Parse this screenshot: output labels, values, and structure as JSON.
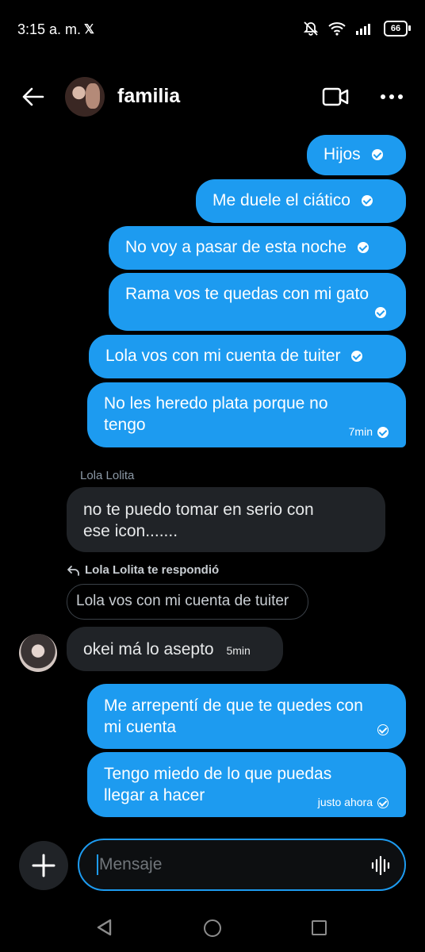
{
  "status_bar": {
    "time": "3:15 a. m.",
    "app_icon": "x-logo",
    "battery": "66"
  },
  "header": {
    "title": "familia"
  },
  "sent_messages_top": [
    {
      "text": "Hijos"
    },
    {
      "text": "Me duele el ciático"
    },
    {
      "text": "No voy a pasar de esta noche"
    },
    {
      "text": "Rama vos te quedas con mi gato"
    },
    {
      "text": "Lola vos con mi cuenta de tuiter"
    },
    {
      "line1": "No les heredo plata porque no",
      "line2": "tengo",
      "time": "7min"
    }
  ],
  "received": {
    "sender": "Lola Lolita",
    "line1": "no te puedo tomar en serio con",
    "line2": "ese icon......."
  },
  "reply": {
    "note": "Lola Lolita te respondió",
    "quoted": "Lola vos con mi cuenta de tuiter",
    "text": "okei má lo asepto",
    "time": "5min"
  },
  "sent_messages_bottom": [
    {
      "line1": "Me arrepentí de que te quedes con",
      "line2": "mi cuenta"
    },
    {
      "line1": "Tengo miedo de lo que puedas",
      "line2": "llegar a hacer",
      "time": "justo ahora"
    }
  ],
  "composer": {
    "placeholder": "Mensaje"
  },
  "colors": {
    "accent": "#1d9bf0",
    "background": "#000000",
    "received_bubble": "#202327"
  }
}
